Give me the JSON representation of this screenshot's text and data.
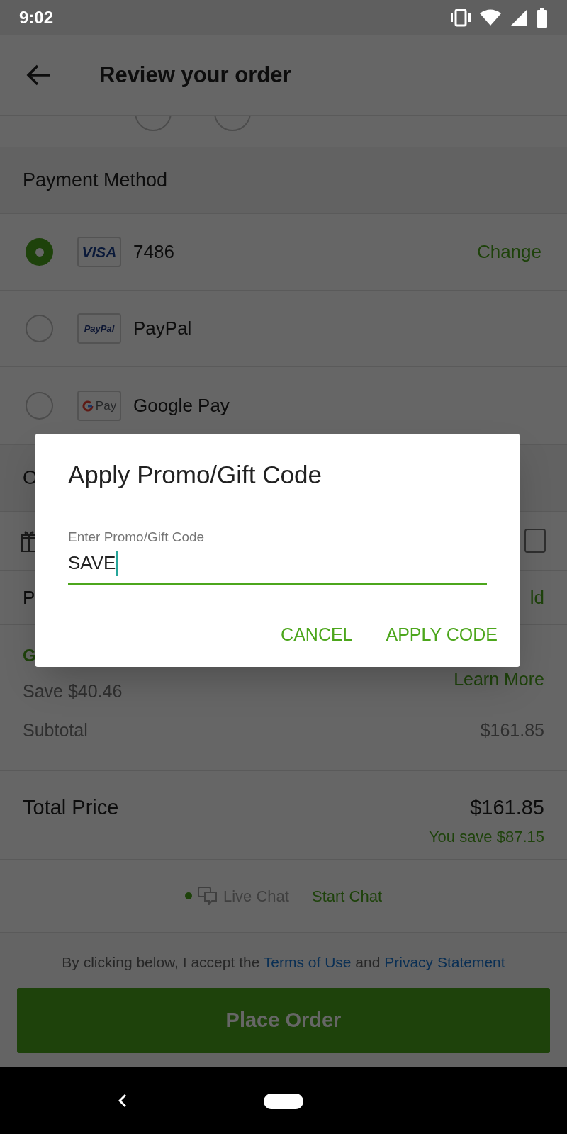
{
  "status_bar": {
    "time": "9:02"
  },
  "app_bar": {
    "title": "Review your order"
  },
  "payment_section": {
    "title": "Payment Method",
    "methods": [
      {
        "kind": "visa",
        "badge": "VISA",
        "label": "7486",
        "selected": true,
        "action": "Change"
      },
      {
        "kind": "paypal",
        "badge": "PayPal",
        "label": "PayPal",
        "selected": false
      },
      {
        "kind": "gpay",
        "badge": "Pay",
        "label": "Google Pay",
        "selected": false
      }
    ]
  },
  "order_section": {
    "title": "O"
  },
  "gift_row": {
    "checked": false
  },
  "promo_row": {
    "label": "P",
    "action": "ld"
  },
  "membership": {
    "title": "G",
    "save": "Save $40.46",
    "link": "Learn More"
  },
  "subtotal": {
    "label": "Subtotal",
    "value": "$161.85"
  },
  "total": {
    "label": "Total Price",
    "value": "$161.85",
    "savings": "You save $87.15"
  },
  "chat": {
    "status": "Live Chat",
    "action": "Start Chat"
  },
  "footer": {
    "terms_prefix": "By clicking below, I accept the",
    "terms_link": "Terms of Use",
    "terms_and": "and",
    "privacy_link": "Privacy Statement",
    "button": "Place Order"
  },
  "dialog": {
    "title": "Apply Promo/Gift Code",
    "field_label": "Enter Promo/Gift Code",
    "value": "SAVE",
    "buttons": [
      "CANCEL",
      "APPLY CODE"
    ]
  }
}
